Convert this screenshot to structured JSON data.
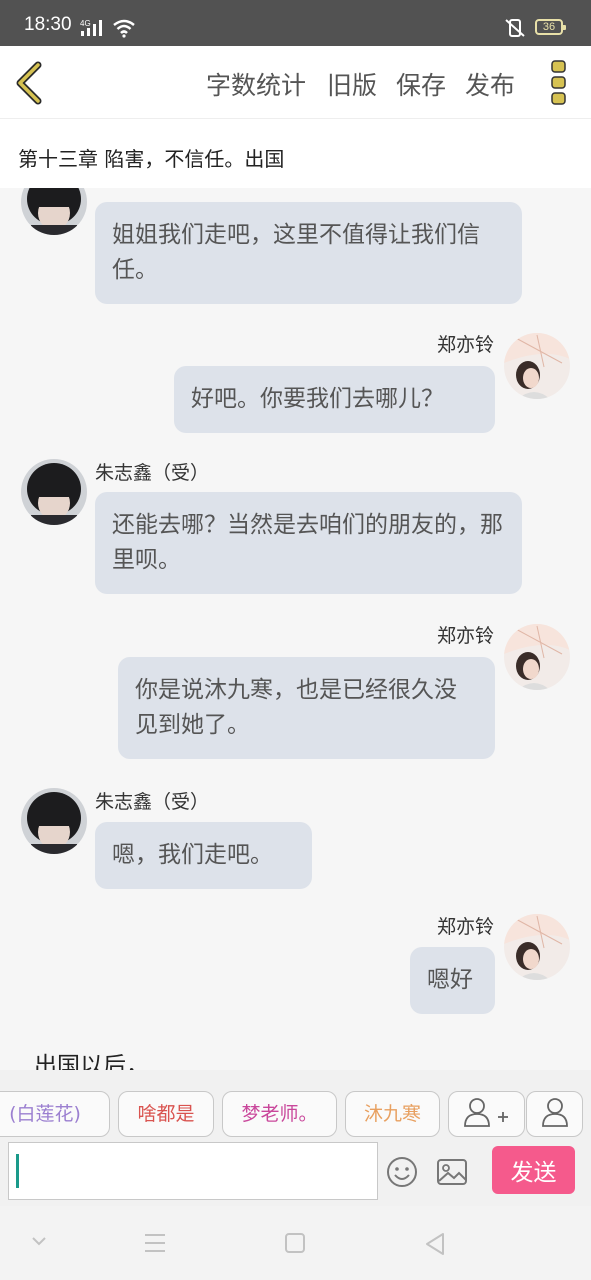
{
  "status_bar": {
    "time": "18:30",
    "network": "4G",
    "battery": "36"
  },
  "toolbar": {
    "back_icon": "chevron-left-icon",
    "word_count_label": "字数统计",
    "old_version_label": "旧版",
    "save_label": "保存",
    "publish_label": "发布",
    "more_icon": "more-vertical-icon",
    "accent_color": "#d6c252"
  },
  "chapter": {
    "title": "第十三章 陷害，不信任。出国"
  },
  "messages": [
    {
      "side": "left",
      "sender": "",
      "text": "姐姐我们走吧，这里不值得让我们信任。"
    },
    {
      "side": "right",
      "sender": "郑亦铃",
      "text": "好吧。你要我们去哪儿？"
    },
    {
      "side": "left",
      "sender": "朱志鑫（受）",
      "text": "还能去哪？当然是去咱们的朋友的，那里呗。"
    },
    {
      "side": "right",
      "sender": "郑亦铃",
      "text": "你是说沐九寒，也是已经很久没见到她了。"
    },
    {
      "side": "left",
      "sender": "朱志鑫（受）",
      "text": "嗯，我们走吧。"
    },
    {
      "side": "right",
      "sender": "郑亦铃",
      "text": "嗯好"
    }
  ],
  "narration": "出国以后，",
  "quick_roles": [
    {
      "label": "(白莲花)",
      "color": "#9b7fd0"
    },
    {
      "label": "啥都是",
      "color": "#d9534f"
    },
    {
      "label": "梦老师。",
      "color": "#c9479b"
    },
    {
      "label": "沐九寒",
      "color": "#e8a060"
    }
  ],
  "quick_icons": [
    "add-user-icon",
    "user-icon"
  ],
  "composer": {
    "input_value": "",
    "emoji_icon": "emoji-icon",
    "image_icon": "image-icon",
    "send_label": "发送",
    "send_color": "#f55a8c"
  },
  "nav_bar": {
    "icons": [
      "nav-down-icon",
      "nav-menu-icon",
      "nav-home-icon",
      "nav-back-icon"
    ]
  }
}
